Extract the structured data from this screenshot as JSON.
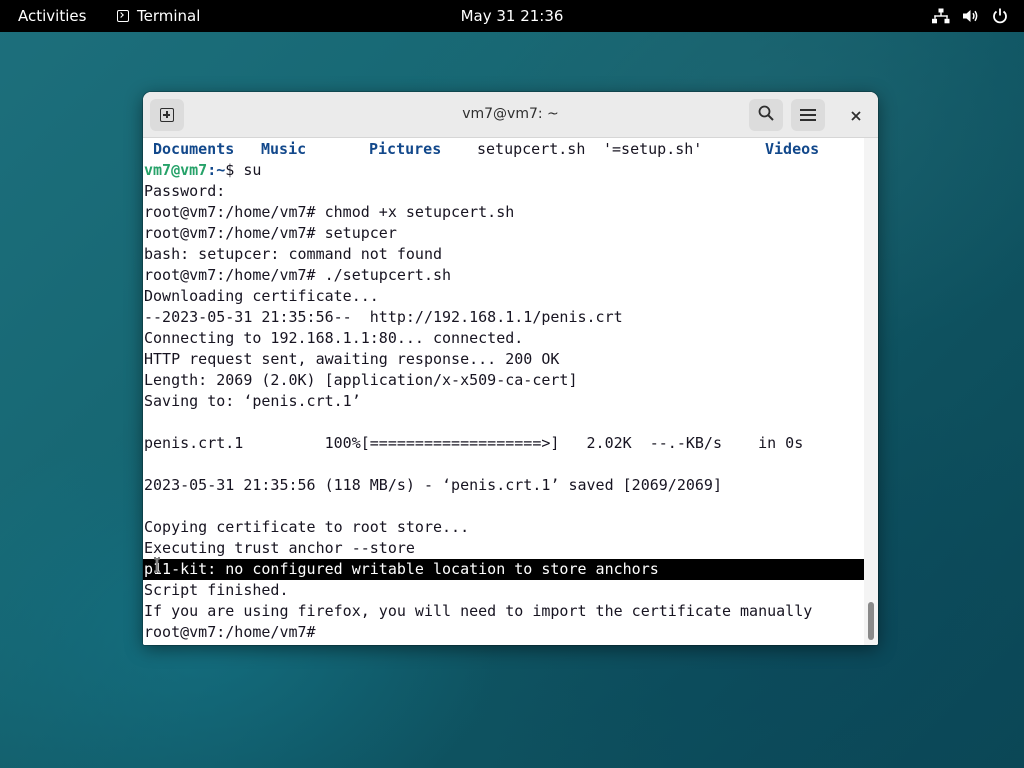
{
  "topbar": {
    "activities": "Activities",
    "app_name": "Terminal",
    "clock": "May 31  21:36",
    "icons": [
      "network-icon",
      "volume-icon",
      "power-icon"
    ]
  },
  "window": {
    "title": "vm7@vm7: ~"
  },
  "terminal": {
    "ls_items": [
      "Documents",
      "Music",
      "Pictures",
      "setupcert.sh",
      "'=setup.sh'",
      "Videos"
    ],
    "prompt_user": "vm7@vm7",
    "prompt_path": ":~",
    "prompt_symbol": "$ ",
    "prompt_command": "su",
    "lines": [
      "Password:",
      "root@vm7:/home/vm7# chmod +x setupcert.sh",
      "root@vm7:/home/vm7# setupcer",
      "bash: setupcer: command not found",
      "root@vm7:/home/vm7# ./setupcert.sh",
      "Downloading certificate...",
      "--2023-05-31 21:35:56--  http://192.168.1.1/penis.crt",
      "Connecting to 192.168.1.1:80... connected.",
      "HTTP request sent, awaiting response... 200 OK",
      "Length: 2069 (2.0K) [application/x-x509-ca-cert]",
      "Saving to: ‘penis.crt.1’",
      "",
      "penis.crt.1         100%[===================>]   2.02K  --.-KB/s    in 0s",
      "",
      "2023-05-31 21:35:56 (118 MB/s) - ‘penis.crt.1’ saved [2069/2069]",
      "",
      "Copying certificate to root store...",
      "Executing trust anchor --store",
      "p11-kit: no configured writable location to store anchors",
      "Script finished.",
      "If you are using firefox, you will need to import the certificate manually",
      "root@vm7:/home/vm7# "
    ],
    "highlighted_line_index": 18
  },
  "colors": {
    "prompt_user": "#26a269",
    "directory": "#12488b",
    "text": "#171421",
    "highlight_bg": "#000000"
  }
}
